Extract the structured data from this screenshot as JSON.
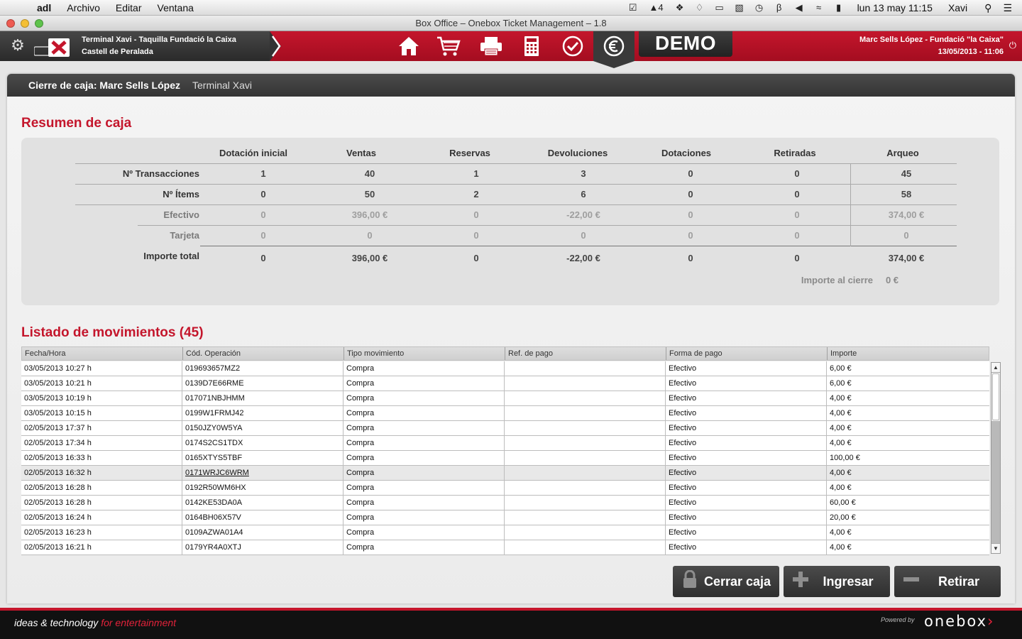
{
  "menubar": {
    "app": "adl",
    "items": [
      "Archivo",
      "Editar",
      "Ventana"
    ],
    "tray_text": "4",
    "clock": "lun 13 may  11:15",
    "user": "Xavi"
  },
  "window": {
    "title": "Box Office – Onebox Ticket Management – 1.8"
  },
  "appbar": {
    "terminal_line1": "Terminal Xavi - Taquilla  Fundació la Caixa",
    "terminal_line2": "Castell de  Peralada",
    "demo": "DEMO",
    "user_line1": "Marc Sells López - Fundació \"la Caixa\"",
    "user_line2": "13/05/2013 - 11:06",
    "nav": [
      "home-icon",
      "cart-icon",
      "printer-icon",
      "calculator-icon",
      "check-icon",
      "euro-icon"
    ],
    "active_nav": "euro-icon",
    "accent": "#c4162c"
  },
  "panel": {
    "title": "Cierre de caja: Marc Sells López",
    "subtitle": "Terminal Xavi"
  },
  "summary": {
    "title": "Resumen de caja",
    "columns": [
      "Dotación inicial",
      "Ventas",
      "Reservas",
      "Devoluciones",
      "Dotaciones",
      "Retiradas",
      "Arqueo"
    ],
    "rows": [
      {
        "label": "Nº Transacciones",
        "values": [
          "1",
          "40",
          "1",
          "3",
          "0",
          "0",
          "45"
        ]
      },
      {
        "label": "Nº Ítems",
        "values": [
          "0",
          "50",
          "2",
          "6",
          "0",
          "0",
          "58"
        ]
      },
      {
        "label": "Efectivo",
        "values": [
          "0",
          "396,00 €",
          "0",
          "-22,00 €",
          "0",
          "0",
          "374,00 €"
        ]
      },
      {
        "label": "Tarjeta",
        "values": [
          "0",
          "0",
          "0",
          "0",
          "0",
          "0",
          "0"
        ]
      },
      {
        "label": "Importe total",
        "values": [
          "0",
          "396,00 €",
          "0",
          "-22,00 €",
          "0",
          "0",
          "374,00 €"
        ]
      }
    ],
    "closing_label": "Importe al cierre",
    "closing_value": "0 €"
  },
  "movements": {
    "title": "Listado de movimientos (45)",
    "columns": [
      "Fecha/Hora",
      "Cód. Operación",
      "Tipo movimiento",
      "Ref. de pago",
      "Forma de pago",
      "Importe"
    ],
    "rows": [
      [
        "03/05/2013 10:27 h",
        "019693657MZ2",
        "Compra",
        "",
        "Efectivo",
        "6,00 €"
      ],
      [
        "03/05/2013 10:21 h",
        "0139D7E66RME",
        "Compra",
        "",
        "Efectivo",
        "6,00 €"
      ],
      [
        "03/05/2013 10:19 h",
        "017071NBJHMM",
        "Compra",
        "",
        "Efectivo",
        "4,00 €"
      ],
      [
        "03/05/2013 10:15 h",
        "0199W1FRMJ42",
        "Compra",
        "",
        "Efectivo",
        "4,00 €"
      ],
      [
        "02/05/2013 17:37 h",
        "0150JZY0W5YA",
        "Compra",
        "",
        "Efectivo",
        "4,00 €"
      ],
      [
        "02/05/2013 17:34 h",
        "0174S2CS1TDX",
        "Compra",
        "",
        "Efectivo",
        "4,00 €"
      ],
      [
        "02/05/2013 16:33 h",
        "0165XTYS5TBF",
        "Compra",
        "",
        "Efectivo",
        "100,00 €"
      ],
      [
        "02/05/2013 16:32 h",
        "0171WRJC6WRM",
        "Compra",
        "",
        "Efectivo",
        "4,00 €"
      ],
      [
        "02/05/2013 16:28 h",
        "0192R50WM6HX",
        "Compra",
        "",
        "Efectivo",
        "4,00 €"
      ],
      [
        "02/05/2013 16:28 h",
        "0142KE53DA0A",
        "Compra",
        "",
        "Efectivo",
        "60,00 €"
      ],
      [
        "02/05/2013 16:24 h",
        "0164BH06X57V",
        "Compra",
        "",
        "Efectivo",
        "20,00 €"
      ],
      [
        "02/05/2013 16:23 h",
        "0109AZWA01A4",
        "Compra",
        "",
        "Efectivo",
        "4,00 €"
      ],
      [
        "02/05/2013 16:21 h",
        "0179YR4A0XTJ",
        "Compra",
        "",
        "Efectivo",
        "4,00 €"
      ]
    ],
    "selected_row": 7
  },
  "buttons": {
    "close": "Cerrar caja",
    "deposit": "Ingresar",
    "withdraw": "Retirar"
  },
  "footer": {
    "tagline_main": "ideas & technology",
    "tagline_accent": "for entertainment",
    "powered": "Powered by",
    "brand": "onebox"
  }
}
